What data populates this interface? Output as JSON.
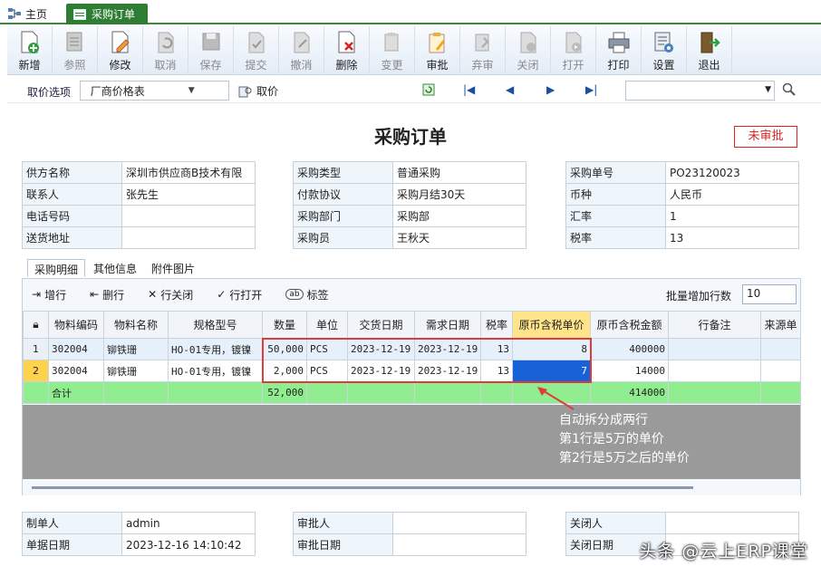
{
  "tabs": {
    "home": "主页",
    "active": "采购订单"
  },
  "toolbar": [
    {
      "label": "新增",
      "icon": "add-doc-icon",
      "enabled": true
    },
    {
      "label": "参照",
      "icon": "reference-icon",
      "enabled": false
    },
    {
      "label": "修改",
      "icon": "edit-icon",
      "enabled": true
    },
    {
      "label": "取消",
      "icon": "undo-icon",
      "enabled": false
    },
    {
      "label": "保存",
      "icon": "save-icon",
      "enabled": false
    },
    {
      "label": "提交",
      "icon": "submit-icon",
      "enabled": false
    },
    {
      "label": "撤消",
      "icon": "revoke-icon",
      "enabled": false
    },
    {
      "label": "删除",
      "icon": "delete-icon",
      "enabled": true
    },
    {
      "label": "变更",
      "icon": "change-icon",
      "enabled": false
    },
    {
      "label": "审批",
      "icon": "approve-icon",
      "enabled": true
    },
    {
      "label": "弃审",
      "icon": "unapprove-icon",
      "enabled": false
    },
    {
      "label": "关闭",
      "icon": "close-doc-icon",
      "enabled": false
    },
    {
      "label": "打开",
      "icon": "open-doc-icon",
      "enabled": false
    },
    {
      "label": "打印",
      "icon": "printer-icon",
      "enabled": true
    },
    {
      "label": "设置",
      "icon": "settings-icon",
      "enabled": true
    },
    {
      "label": "退出",
      "icon": "exit-icon",
      "enabled": true
    }
  ],
  "options": {
    "label": "取价选项",
    "price_source": "厂商价格表",
    "fetch_label": "取价",
    "search_value": ""
  },
  "doc": {
    "title": "采购订单",
    "status": "未审批"
  },
  "header_left": [
    {
      "k": "供方名称",
      "v": "深圳市供应商B技术有限"
    },
    {
      "k": "联系人",
      "v": "张先生"
    },
    {
      "k": "电话号码",
      "v": ""
    },
    {
      "k": "送货地址",
      "v": ""
    }
  ],
  "header_mid": [
    {
      "k": "采购类型",
      "v": "普通采购"
    },
    {
      "k": "付款协议",
      "v": "采购月结30天"
    },
    {
      "k": "采购部门",
      "v": "采购部"
    },
    {
      "k": "采购员",
      "v": "王秋天"
    }
  ],
  "header_right": [
    {
      "k": "采购单号",
      "v": "PO23120023"
    },
    {
      "k": "币种",
      "v": "人民币"
    },
    {
      "k": "汇率",
      "v": "1"
    },
    {
      "k": "税率",
      "v": "13"
    }
  ],
  "detail_tabs": [
    "采购明细",
    "其他信息",
    "附件图片"
  ],
  "grid_actions": [
    "增行",
    "删行",
    "行关闭",
    "行打开",
    "标签"
  ],
  "batch": {
    "label": "批量增加行数",
    "value": "10"
  },
  "columns": [
    "物料编码",
    "物料名称",
    "规格型号",
    "数量",
    "单位",
    "交货日期",
    "需求日期",
    "税率",
    "原币含税单价",
    "原币含税金额",
    "行备注",
    "来源单"
  ],
  "rows": [
    {
      "no": "1",
      "code": "302004",
      "name": "铆铁珊",
      "spec": "HO-01专用，镀镍",
      "qty": "50,000",
      "unit": "PCS",
      "deliver": "2023-12-19",
      "need": "2023-12-19",
      "tax": "13",
      "price": "8",
      "amount": "400000",
      "memo": "",
      "src": ""
    },
    {
      "no": "2",
      "code": "302004",
      "name": "铆铁珊",
      "spec": "HO-01专用，镀镍",
      "qty": "2,000",
      "unit": "PCS",
      "deliver": "2023-12-19",
      "need": "2023-12-19",
      "tax": "13",
      "price": "7",
      "amount": "14000",
      "memo": "",
      "src": ""
    }
  ],
  "total": {
    "label": "合计",
    "qty": "52,000",
    "amount": "414000"
  },
  "annotation": [
    "自动拆分成两行",
    "第1行是5万的单价",
    "第2行是5万之后的单价"
  ],
  "footer_left": [
    {
      "k": "制单人",
      "v": "admin"
    },
    {
      "k": "单据日期",
      "v": "2023-12-16 14:10:42"
    }
  ],
  "footer_mid": [
    {
      "k": "审批人",
      "v": ""
    },
    {
      "k": "审批日期",
      "v": ""
    }
  ],
  "footer_right": [
    {
      "k": "关闭人",
      "v": ""
    },
    {
      "k": "关闭日期",
      "v": ""
    }
  ],
  "watermark": "头条 @云上ERP课堂"
}
